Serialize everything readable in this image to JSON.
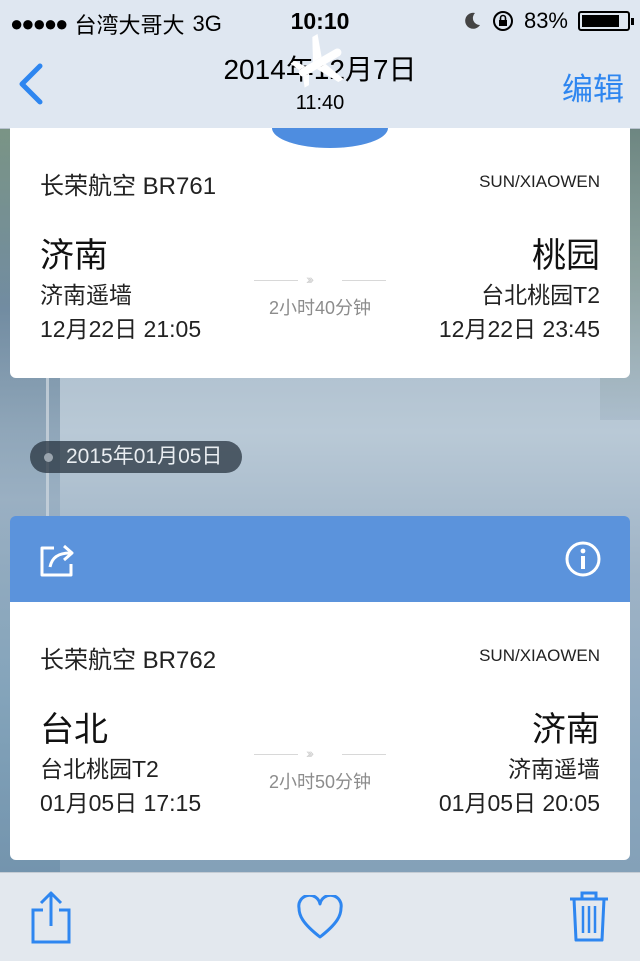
{
  "status_bar": {
    "carrier": "台湾大哥大",
    "network": "3G",
    "time": "10:10",
    "battery": "83%",
    "battery_level": 0.83
  },
  "nav": {
    "back_icon": "chevron-left-icon",
    "title": "2014年12月7日",
    "subtitle": "11:40",
    "edit_label": "编辑"
  },
  "flights": [
    {
      "airline": "长荣航空 BR761",
      "passenger": "SUN/XIAOWEN",
      "from_city": "济南",
      "from_airport": "济南遥墙",
      "depart": "12月22日 21:05",
      "to_city": "桃园",
      "to_airport": "台北桃园T2",
      "arrive": "12月22日 23:45",
      "duration": "2小时40分钟"
    },
    {
      "airline": "长荣航空 BR762",
      "passenger": "SUN/XIAOWEN",
      "from_city": "台北",
      "from_airport": "台北桃园T2",
      "depart": "01月05日 17:15",
      "to_city": "济南",
      "to_airport": "济南遥墙",
      "arrive": "01月05日 20:05",
      "duration": "2小时50分钟"
    }
  ],
  "timeline": {
    "date_label": "2015年01月05日"
  },
  "toolbar": {
    "share_icon": "share-icon",
    "favorite_icon": "heart-icon",
    "delete_icon": "trash-icon"
  },
  "colors": {
    "accent": "#2e86f0",
    "card_header": "#5b93dc",
    "bar_bg": "#dfe7f1"
  }
}
